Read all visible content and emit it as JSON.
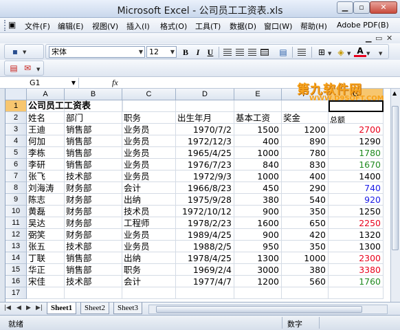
{
  "window": {
    "title": "Microsoft Excel - 公司员工工资表.xls"
  },
  "menu": {
    "items": [
      "文件(F)",
      "编辑(E)",
      "视图(V)",
      "插入(I)",
      "格式(O)",
      "工具(T)",
      "数据(D)",
      "窗口(W)",
      "帮助(H)",
      "Adobe PDF(B)"
    ]
  },
  "format_toolbar": {
    "font": "宋体",
    "font_size": "12"
  },
  "formula_bar": {
    "name_box": "G1",
    "fx": "fx",
    "content": ""
  },
  "watermark": {
    "main": "第九软件网",
    "sub": "WWW.D9SOFT.COM"
  },
  "columns": [
    "A",
    "B",
    "C",
    "D",
    "E",
    "F",
    "G"
  ],
  "rows": [
    "1",
    "2",
    "3",
    "4",
    "5",
    "6",
    "7",
    "8",
    "9",
    "10",
    "11",
    "12",
    "13",
    "14",
    "15",
    "16",
    "17"
  ],
  "sheet": {
    "title": "公司员工工资表",
    "headers": {
      "name": "姓名",
      "dept": "部门",
      "role": "职务",
      "birth": "出生年月",
      "base": "基本工资",
      "bonus": "奖金",
      "total": "总额"
    },
    "records": [
      {
        "name": "王迪",
        "dept": "销售部",
        "role": "业务员",
        "birth": "1970/7/2",
        "base": "1500",
        "bonus": "1200",
        "total": "2700",
        "color": "#e8001c"
      },
      {
        "name": "何加",
        "dept": "销售部",
        "role": "业务员",
        "birth": "1972/12/3",
        "base": "400",
        "bonus": "890",
        "total": "1290",
        "color": "#000000"
      },
      {
        "name": "李栋",
        "dept": "销售部",
        "role": "业务员",
        "birth": "1965/4/25",
        "base": "1000",
        "bonus": "780",
        "total": "1780",
        "color": "#1f8a1f"
      },
      {
        "name": "李研",
        "dept": "销售部",
        "role": "业务员",
        "birth": "1976/7/23",
        "base": "840",
        "bonus": "830",
        "total": "1670",
        "color": "#1f8a1f"
      },
      {
        "name": "张飞",
        "dept": "技术部",
        "role": "业务员",
        "birth": "1972/9/3",
        "base": "1000",
        "bonus": "400",
        "total": "1400",
        "color": "#000000"
      },
      {
        "name": "刘海涛",
        "dept": "财务部",
        "role": "会计",
        "birth": "1966/8/23",
        "base": "450",
        "bonus": "290",
        "total": "740",
        "color": "#1a1ae6"
      },
      {
        "name": "陈志",
        "dept": "财务部",
        "role": "出纳",
        "birth": "1975/9/28",
        "base": "380",
        "bonus": "540",
        "total": "920",
        "color": "#1a1ae6"
      },
      {
        "name": "黄磊",
        "dept": "财务部",
        "role": "技术员",
        "birth": "1972/10/12",
        "base": "900",
        "bonus": "350",
        "total": "1250",
        "color": "#000000"
      },
      {
        "name": "吴达",
        "dept": "财务部",
        "role": "工程师",
        "birth": "1978/2/23",
        "base": "1600",
        "bonus": "650",
        "total": "2250",
        "color": "#e8001c"
      },
      {
        "name": "弼笑",
        "dept": "财务部",
        "role": "业务员",
        "birth": "1989/4/25",
        "base": "900",
        "bonus": "420",
        "total": "1320",
        "color": "#000000"
      },
      {
        "name": "张五",
        "dept": "技术部",
        "role": "业务员",
        "birth": "1988/2/5",
        "base": "950",
        "bonus": "350",
        "total": "1300",
        "color": "#000000"
      },
      {
        "name": "丁联",
        "dept": "销售部",
        "role": "出纳",
        "birth": "1978/4/25",
        "base": "1300",
        "bonus": "1000",
        "total": "2300",
        "color": "#e8001c"
      },
      {
        "name": "华正",
        "dept": "销售部",
        "role": "职务",
        "birth": "1969/2/4",
        "base": "3000",
        "bonus": "380",
        "total": "3380",
        "color": "#e8001c"
      },
      {
        "name": "宋佳",
        "dept": "技术部",
        "role": "会计",
        "birth": "1977/4/7",
        "base": "1200",
        "bonus": "560",
        "total": "1760",
        "color": "#1f8a1f"
      }
    ]
  },
  "sheet_tabs": [
    "Sheet1",
    "Sheet2",
    "Sheet3"
  ],
  "status": {
    "ready": "就绪",
    "mode": "数字"
  }
}
